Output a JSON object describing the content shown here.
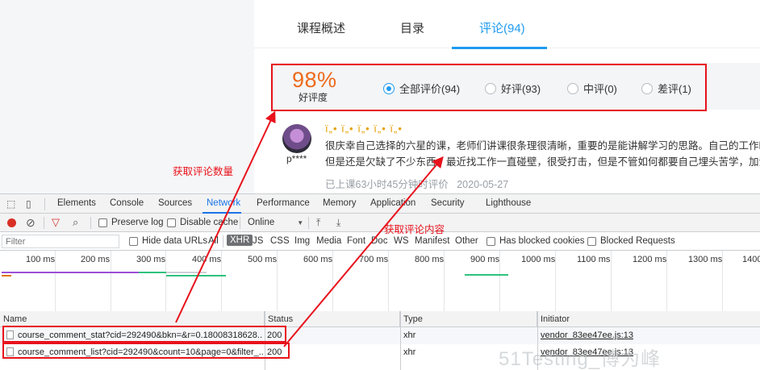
{
  "course_page": {
    "tabs": [
      "课程概述",
      "目录",
      "评论(94)"
    ],
    "active_tab": 2,
    "accent_color": "#1f9bf0",
    "rating": {
      "percent": "98%",
      "label": "好评度",
      "filters": [
        {
          "label": "全部评价(94)",
          "selected": true
        },
        {
          "label": "好评(93)",
          "selected": false
        },
        {
          "label": "中评(0)",
          "selected": false
        },
        {
          "label": "差评(1)",
          "selected": false
        }
      ]
    },
    "comment": {
      "avatar_icon": "avatar-photo",
      "username": "p****",
      "display_name": "ï„• ï„• ï„• ï„• ï„•",
      "line1": "很庆幸自己选择的六星的课，老师们讲课很条理很清晰，重要的是能讲解学习的思路。自己的工作时",
      "line2": "但是还是欠缺了不少东西，最近找工作一直碰壁，很受打击，但是不管如何都要自己埋头苦学，加油",
      "meta": "已上课63小时45分钟时评价",
      "date": "2020-05-27"
    }
  },
  "devtools": {
    "tabs": [
      "Elements",
      "Console",
      "Sources",
      "Network",
      "Performance",
      "Memory",
      "Application",
      "Security",
      "Lighthouse"
    ],
    "active_tab": 3,
    "toolbar": {
      "preserve_log": "Preserve log",
      "disable_cache": "Disable cache",
      "throttle": "Online",
      "throttle_arrow": "▼"
    },
    "filter": {
      "placeholder": "Filter",
      "hide_data_urls": "Hide data URLs",
      "types": [
        "All",
        "XHR",
        "JS",
        "CSS",
        "Img",
        "Media",
        "Font",
        "Doc",
        "WS",
        "Manifest",
        "Other"
      ],
      "active_type": "XHR",
      "has_blocked_cookies": "Has blocked cookies",
      "blocked_requests": "Blocked Requests"
    },
    "timeline_ticks": [
      "100 ms",
      "200 ms",
      "300 ms",
      "400 ms",
      "500 ms",
      "600 ms",
      "700 ms",
      "800 ms",
      "900 ms",
      "1000 ms",
      "1100 ms",
      "1200 ms",
      "1300 ms",
      "1400"
    ],
    "table": {
      "headers": [
        "Name",
        "Status",
        "Type",
        "Initiator"
      ],
      "rows": [
        {
          "name": "course_comment_stat?cid=292490&bkn=&r=0.18008318628...",
          "status": "200",
          "type": "xhr",
          "initiator": "vendor_83ee47ee.js:13"
        },
        {
          "name": "course_comment_list?cid=292490&count=10&page=0&filter_...",
          "status": "200",
          "type": "xhr",
          "initiator": "vendor_83ee47ee.js:13"
        }
      ]
    }
  },
  "annotations": {
    "count_label": "获取评论数量",
    "content_label": "获取评论内容",
    "color": "#e8121c"
  },
  "watermark": "51Testing_博为峰"
}
